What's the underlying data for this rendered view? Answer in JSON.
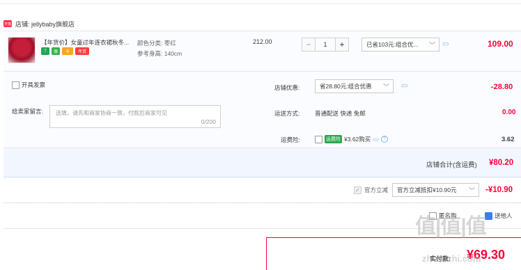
{
  "shop": {
    "icon_text": "天猫",
    "label": "店铺: jellybaby旗舰店"
  },
  "item": {
    "title": "【年货价】女童过年连衣裙秋冬...",
    "badges": [
      "7",
      "保",
      "卡",
      "年货"
    ],
    "prop_color": "颜色分类: 枣红",
    "prop_height": "参考身高: 140cm",
    "unit_price": "212.00",
    "qty_minus": "−",
    "qty_value": "1",
    "qty_plus": "+",
    "discount_select": "已省103元:组合优...",
    "total": "109.00"
  },
  "invoice": {
    "label": "开具发票"
  },
  "message": {
    "label": "给卖家留言:",
    "placeholder": "选填，请先和商家协商一致，付款后商家可见",
    "counter": "0/200"
  },
  "shop_discount": {
    "label": "店铺优惠:",
    "select": "省28.80元:组合优惠",
    "value": "-28.80"
  },
  "shipping": {
    "label": "运送方式:",
    "desc": "普通配送 快递 免邮",
    "value": "0.00"
  },
  "insurance": {
    "label": "运费险:",
    "tag": "运费险",
    "text": "¥3.62购买",
    "value": "3.62"
  },
  "subtotal": {
    "label": "店铺合计(含运费)",
    "value": "¥80.20"
  },
  "official": {
    "label": "官方立减",
    "select": "官方立减抵扣¥10.90元",
    "value": "-¥10.90"
  },
  "options": {
    "anonymous": "匿名购",
    "gift": "送他人"
  },
  "payment": {
    "label": "实付款:",
    "value": "¥69.30"
  },
  "watermark": {
    "logo": "值|值|值",
    "site": "zhizhizhi.com"
  },
  "colors": {
    "accent": "#ff0036",
    "link": "#7ab4e8",
    "panel": "#fbfcff"
  }
}
